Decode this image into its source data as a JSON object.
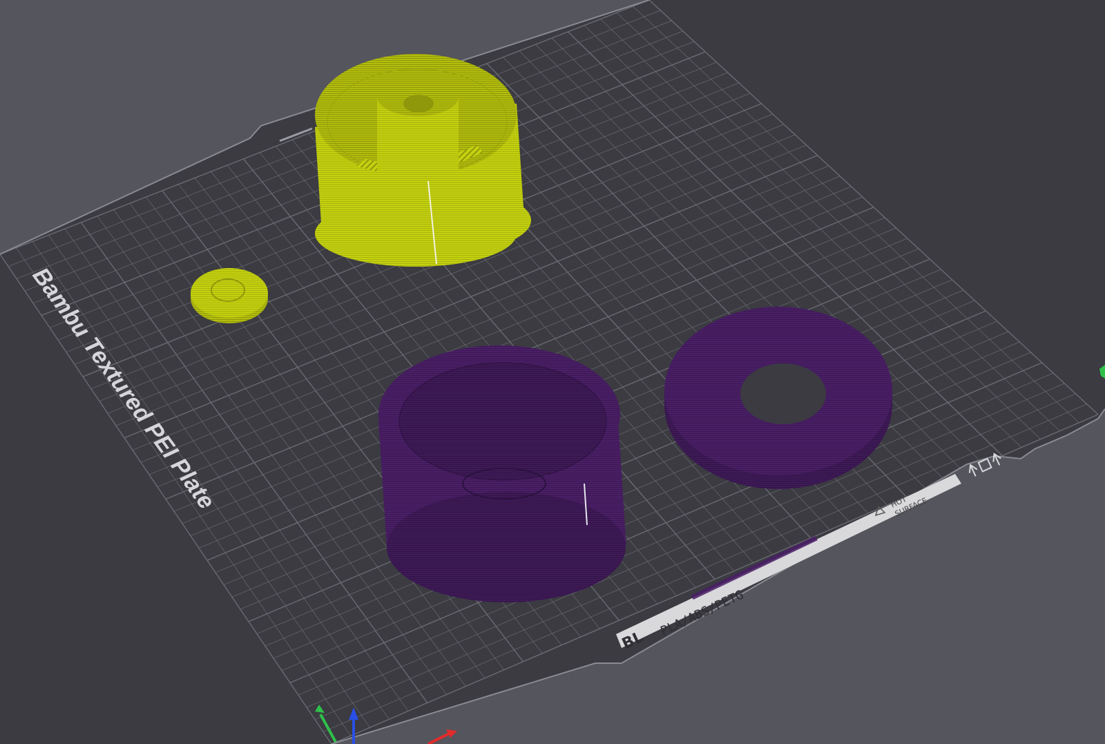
{
  "viewport": {
    "background": "#55555d"
  },
  "plate": {
    "name": "Bambu Textured PEI Plate",
    "surface_color": "#3b3b41",
    "grid_color": "#6a6a72",
    "edge_color": "#8a8a92",
    "label_color": "#d6d6da"
  },
  "plate_strip": {
    "material": "PLA/ABS/PETG",
    "warning": [
      "HOT",
      "SURFACE"
    ],
    "logo": "BL"
  },
  "objects": [
    {
      "name": "yellow-cup",
      "filament": "yellow",
      "color": "#c4d10f"
    },
    {
      "name": "yellow-cap",
      "filament": "yellow",
      "color": "#c4d10f"
    },
    {
      "name": "purple-cup",
      "filament": "purple",
      "color": "#4a1f66"
    },
    {
      "name": "purple-ring",
      "filament": "purple",
      "color": "#4a1f66"
    }
  ],
  "axes": {
    "x_color": "#e22b2b",
    "y_color": "#2fc04a",
    "z_color": "#2a4fe6"
  }
}
